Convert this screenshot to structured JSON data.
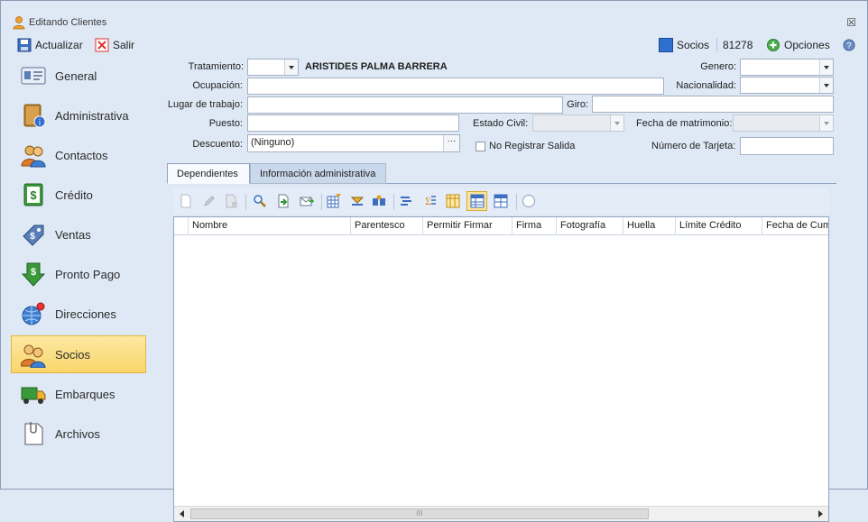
{
  "window": {
    "title": "Editando Clientes",
    "close_glyph": "☒"
  },
  "toolbar": {
    "save_label": "Actualizar",
    "exit_label": "Salir",
    "socios_label": "Socios",
    "record_number": "81278",
    "options_label": "Opciones"
  },
  "sidebar": {
    "items": [
      {
        "label": "General",
        "icon": "id-card-icon"
      },
      {
        "label": "Administrativa",
        "icon": "book-info-icon"
      },
      {
        "label": "Contactos",
        "icon": "people-icon"
      },
      {
        "label": "Crédito",
        "icon": "money-icon"
      },
      {
        "label": "Ventas",
        "icon": "price-tag-icon"
      },
      {
        "label": "Pronto Pago",
        "icon": "money-down-icon"
      },
      {
        "label": "Direcciones",
        "icon": "globe-pin-icon"
      },
      {
        "label": "Socios",
        "icon": "partners-icon"
      },
      {
        "label": "Embarques",
        "icon": "truck-icon"
      },
      {
        "label": "Archivos",
        "icon": "document-clip-icon"
      }
    ],
    "active": "Socios"
  },
  "form": {
    "tratamiento_label": "Tratamiento:",
    "tratamiento_value": "",
    "client_name": "ARISTIDES PALMA BARRERA",
    "genero_label": "Genero:",
    "genero_value": "",
    "ocupacion_label": "Ocupación:",
    "ocupacion_value": "",
    "nacionalidad_label": "Nacionalidad:",
    "nacionalidad_value": "",
    "lugar_label": "Lugar de trabajo:",
    "lugar_value": "",
    "giro_label": "Giro:",
    "giro_value": "",
    "puesto_label": "Puesto:",
    "puesto_value": "",
    "estado_civil_label": "Estado Civil:",
    "estado_civil_value": "",
    "fecha_mat_label": "Fecha de matrimonio:",
    "fecha_mat_value": "",
    "descuento_label": "Descuento:",
    "descuento_value": "(Ninguno)",
    "ellipsis": "···",
    "no_registrar_label": "No Registrar Salida",
    "no_registrar_checked": false,
    "num_tarjeta_label": "Número de Tarjeta:",
    "num_tarjeta_value": ""
  },
  "tabs": [
    {
      "label": "Dependientes",
      "active": true
    },
    {
      "label": "Información administrativa",
      "active": false
    }
  ],
  "grid": {
    "columns": [
      "Nombre",
      "Parentesco",
      "Permitir Firmar",
      "Firma",
      "Fotografía",
      "Huella",
      "Límite Crédito",
      "Fecha de Cum"
    ],
    "rows": [],
    "scroll_grip": "III"
  },
  "colors": {
    "background": "#dfe9f5",
    "active_item": "#fbd96c",
    "socios_swatch": "#2f6fd0"
  }
}
